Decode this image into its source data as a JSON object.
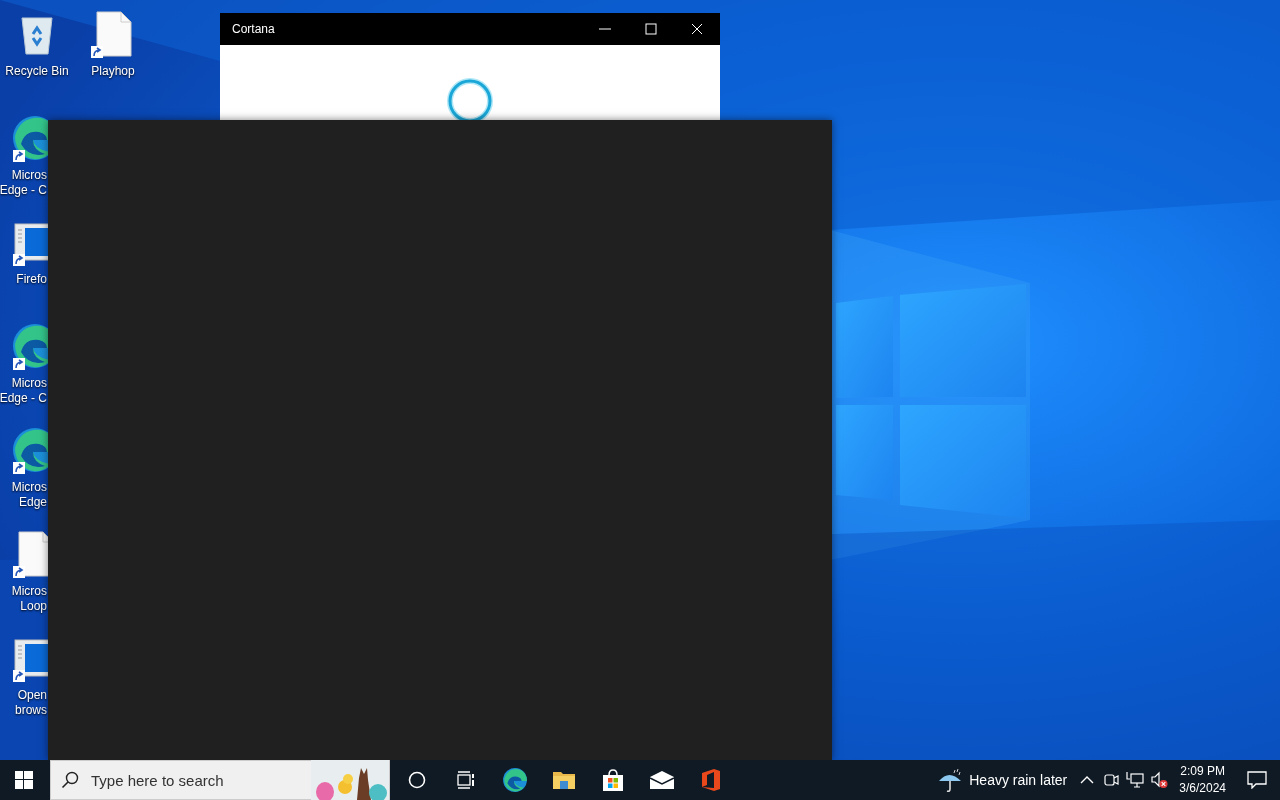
{
  "desktop": {
    "columns": [
      [
        {
          "kind": "recycle-bin",
          "label_lines": [
            "Recycle Bin"
          ]
        },
        {
          "kind": "edge",
          "label_lines": [
            "Micros",
            "Edge - C"
          ]
        },
        {
          "kind": "browser-window",
          "label_lines": [
            "Firefo"
          ]
        },
        {
          "kind": "edge",
          "label_lines": [
            "Micros",
            "Edge - C"
          ]
        },
        {
          "kind": "edge",
          "label_lines": [
            "Micros",
            "Edge"
          ]
        },
        {
          "kind": "file",
          "label_lines": [
            "Micros",
            "Loop"
          ]
        },
        {
          "kind": "browser-window",
          "label_lines": [
            "Open",
            "brows"
          ]
        }
      ],
      [
        {
          "kind": "file",
          "label_lines": [
            "Playhop"
          ]
        }
      ]
    ]
  },
  "window": {
    "title": "Cortana"
  },
  "taskbar": {
    "search": {
      "placeholder": "Type here to search"
    },
    "pinned": [
      {
        "kind": "cortana"
      },
      {
        "kind": "task-view"
      },
      {
        "kind": "edge"
      },
      {
        "kind": "folder"
      },
      {
        "kind": "store"
      },
      {
        "kind": "mail"
      },
      {
        "kind": "office"
      }
    ],
    "weather": "Heavy rain later",
    "tray": [
      {
        "kind": "caret"
      },
      {
        "kind": "camera"
      },
      {
        "kind": "network"
      },
      {
        "kind": "volume-muted"
      }
    ],
    "clock": {
      "time": "2:09 PM",
      "date": "3/6/2024"
    }
  }
}
